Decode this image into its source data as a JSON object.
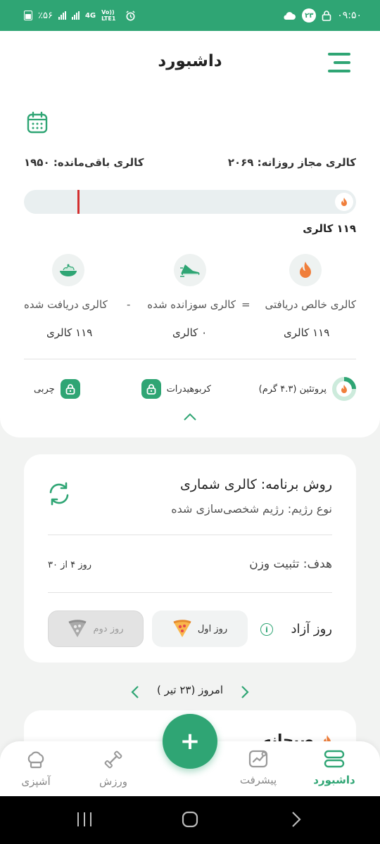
{
  "status_bar": {
    "time": "۰۹:۵۰",
    "badge": "۲۳",
    "battery": "٪۵۶",
    "network": "4G",
    "volte": "Vo)) LTE1"
  },
  "header": {
    "title": "داشبورد"
  },
  "summary": {
    "daily_allowance": "کالری مجاز روزانه: ۲۰۶۹",
    "remaining": "کالری باقی‌مانده: ۱۹۵۰",
    "progress_fraction": 0.058,
    "progress_label": "۱۱۹ کالری"
  },
  "stats": {
    "net": {
      "label": "کالری خالص دریافتی",
      "value": "۱۱۹ کالری"
    },
    "equals": "=",
    "burned": {
      "label": "کالری سوزانده شده",
      "value": "۰ کالری"
    },
    "minus": "-",
    "intake": {
      "label": "کالری دریافت شده",
      "value": "۱۱۹ کالری"
    }
  },
  "macros": {
    "protein": "پروتئین (۴.۳ گرم)",
    "carbs": "کربوهیدرات",
    "fat": "چربی"
  },
  "plan": {
    "method": "روش برنامه: کالری شماری",
    "diet_type": "نوع رژیم: رژیم شخصی‌سازی شده",
    "goal": "هدف: تثبیت وزن",
    "day_of": "روز ۴ از ۳۰",
    "free_day": "روز آزاد",
    "info": "i",
    "first_day": "روز اول",
    "second_day": "روز دوم"
  },
  "date_nav": {
    "label": "امروز (۲۳ تیر )"
  },
  "meal": {
    "title": "صبحانه"
  },
  "bottom_nav": {
    "dashboard": "داشبورد",
    "progress": "پیشرفت",
    "exercise": "ورزش",
    "cooking": "آشپزی",
    "fab": "+"
  },
  "colors": {
    "primary": "#2fa574",
    "marker": "#d32f2f",
    "flame": "#f07f3c"
  }
}
